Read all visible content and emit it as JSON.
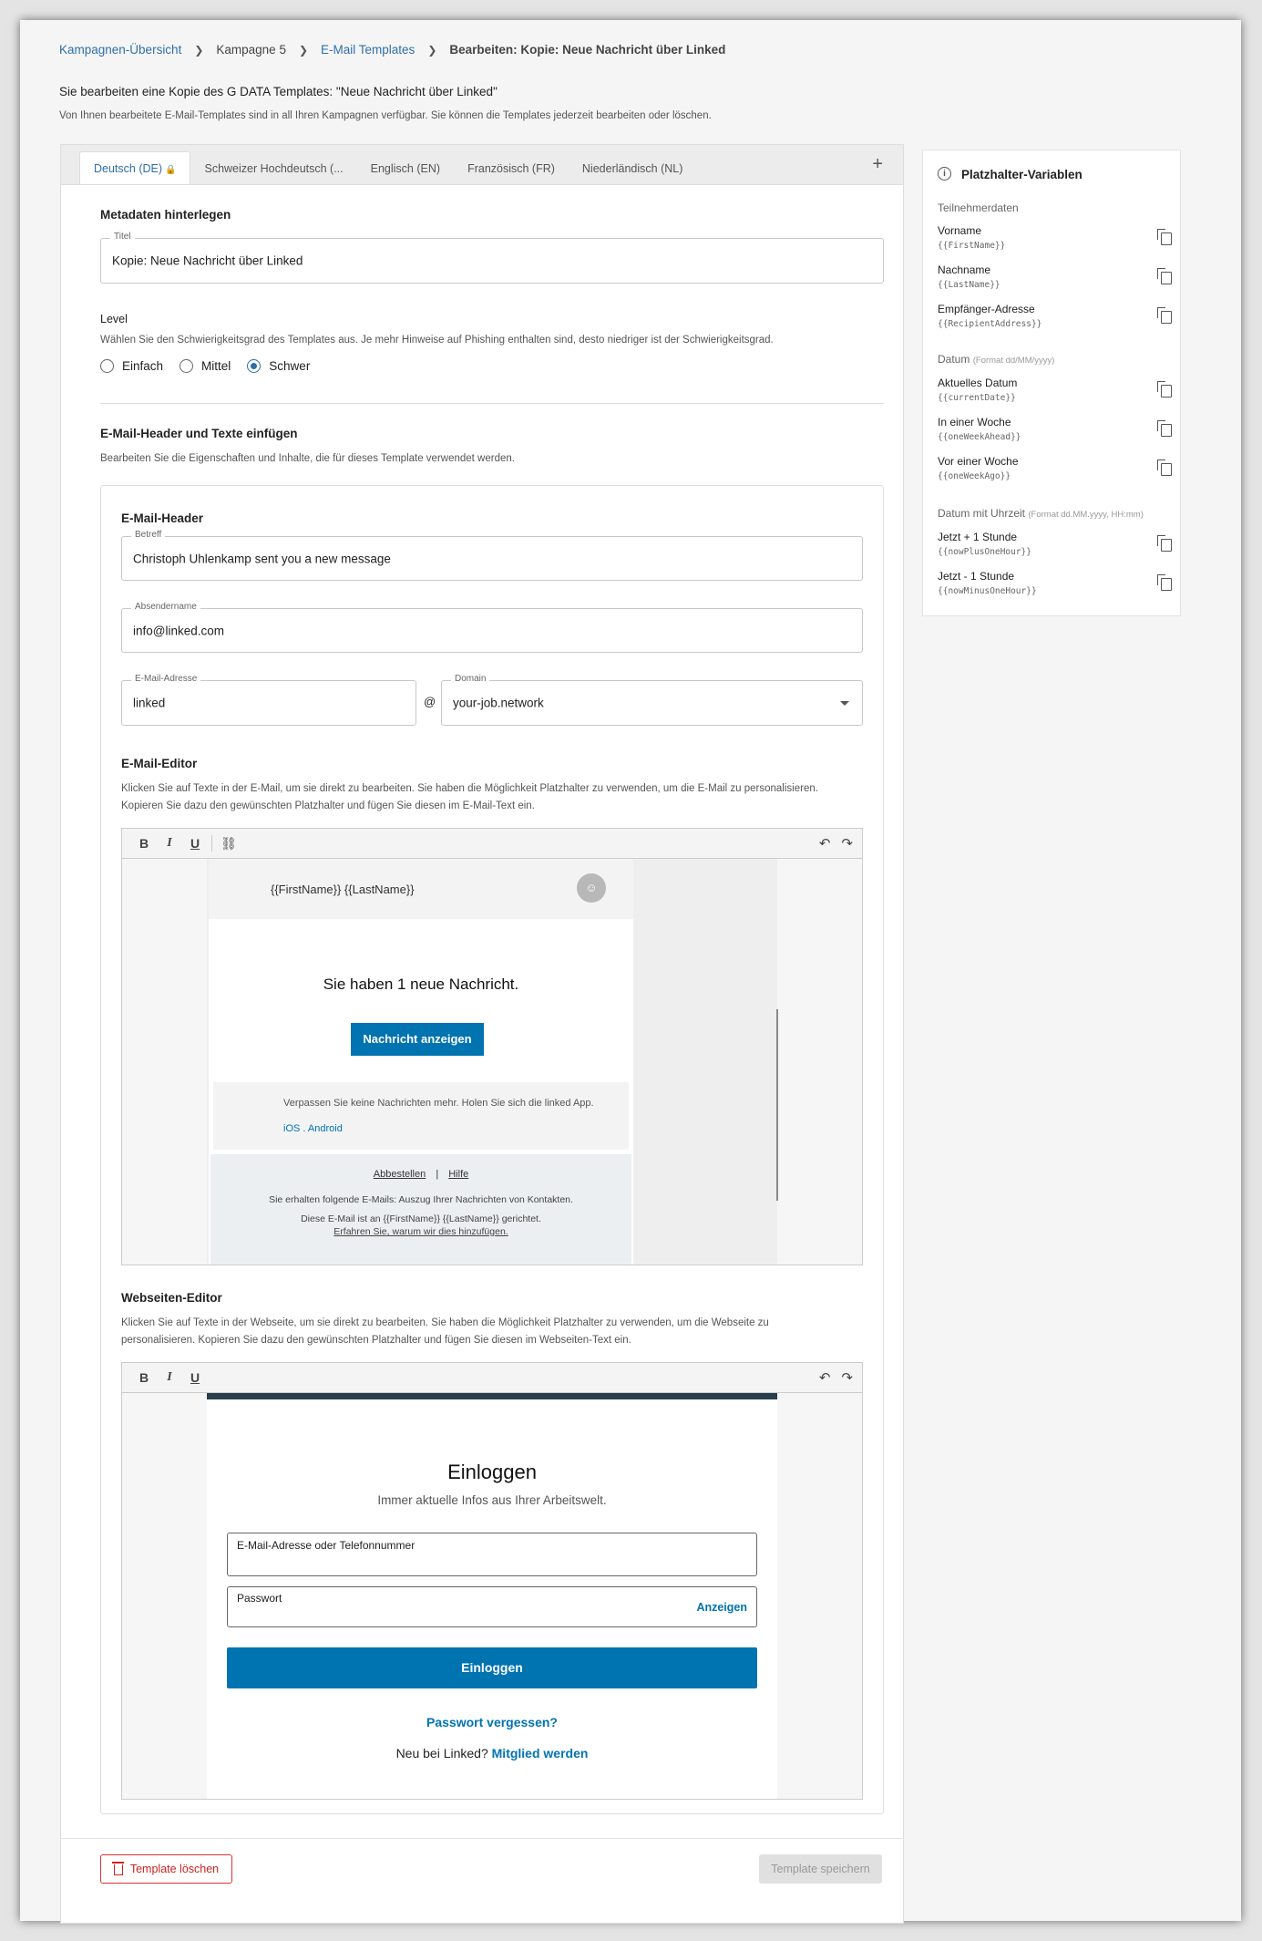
{
  "breadcrumb": {
    "items": [
      "Kampagnen-Übersicht",
      "Kampagne 5",
      "E-Mail Templates",
      "Bearbeiten: Kopie: Neue Nachricht über Linked"
    ]
  },
  "intro": {
    "title": "Sie bearbeiten eine Kopie des G DATA Templates: \"Neue Nachricht über Linked\"",
    "description": "Von Ihnen bearbeitete E-Mail-Templates sind in all Ihren Kampagnen verfügbar. Sie können die Templates jederzeit bearbeiten oder löschen."
  },
  "tabs": [
    {
      "label": "Deutsch (DE)"
    },
    {
      "label": "Schweizer Hochdeutsch (..."
    },
    {
      "label": "Englisch (EN)"
    },
    {
      "label": "Französisch (FR)"
    },
    {
      "label": "Niederländisch (NL)"
    }
  ],
  "add_tab": "+",
  "metadata": {
    "heading": "Metadaten hinterlegen",
    "title_label": "Titel",
    "title_value": "Kopie: Neue Nachricht über Linked"
  },
  "level": {
    "heading": "Level",
    "description": "Wählen Sie den Schwierigkeitsgrad des Templates aus. Je mehr Hinweise auf Phishing enthalten sind, desto niedriger ist der Schwierigkeitsgrad.",
    "options": [
      "Einfach",
      "Mittel",
      "Schwer"
    ],
    "selected": "Schwer"
  },
  "section": {
    "heading": "E-Mail-Header und Texte einfügen",
    "description": "Bearbeiten Sie die Eigenschaften und Inhalte, die für dieses Template verwendet werden."
  },
  "email_header": {
    "heading": "E-Mail-Header",
    "subject_label": "Betreff",
    "subject_value": "Christoph Uhlenkamp sent you a new message",
    "sender_label": "Absendername",
    "sender_value": "info@linked.com",
    "address_label": "E-Mail-Adresse",
    "address_value": "linked",
    "at": "@",
    "domain_label": "Domain",
    "domain_value": "your-job.network"
  },
  "email_editor": {
    "heading": "E-Mail-Editor",
    "description_1": "Klicken Sie auf Texte in der E-Mail, um sie direkt zu bearbeiten. Sie haben die Möglichkeit Platzhalter zu verwenden, um die E-Mail zu personalisieren.",
    "description_2": "Kopieren Sie dazu den gewünschten Platzhalter und fügen Sie diesen im E-Mail-Text ein."
  },
  "toolbar": {
    "bold": "B",
    "italic": "I",
    "underline": "U",
    "link": "⛓",
    "undo": "↶",
    "redo": "↷"
  },
  "mail": {
    "name": "{{FirstName}} {{LastName}}",
    "headline": "Sie haben 1 neue Nachricht.",
    "button": "Nachricht anzeigen",
    "app_text": "Verpassen Sie keine Nachrichten mehr. Holen Sie sich die linked App.",
    "ios": "iOS",
    "dot": ".",
    "android": "Android",
    "unsubscribe": "Abbestellen",
    "pipe": "|",
    "help": "Hilfe",
    "info": "Sie erhalten folgende E-Mails: Auszug Ihrer Nachrichten von Kontakten.",
    "addressed": "Diese E-Mail ist an {{FirstName}} {{LastName}} gerichtet.",
    "why": "Erfahren Sie, warum wir dies hinzufügen."
  },
  "web_editor": {
    "heading": "Webseiten-Editor",
    "description_1": "Klicken Sie auf Texte in der Webseite, um sie direkt zu bearbeiten. Sie haben die Möglichkeit Platzhalter zu verwenden, um die Webseite zu",
    "description_2": "personalisieren. Kopieren Sie dazu den gewünschten Platzhalter und fügen Sie diesen im Webseiten-Text ein."
  },
  "web": {
    "title": "Einloggen",
    "subtitle": "Immer aktuelle Infos aus Ihrer Arbeitswelt.",
    "email_placeholder": "E-Mail-Adresse oder Telefonnummer",
    "password_placeholder": "Passwort",
    "show": "Anzeigen",
    "login_button": "Einloggen",
    "forgot": "Passwort vergessen?",
    "new_text": "Neu bei Linked?",
    "join": "Mitglied werden"
  },
  "footer": {
    "delete": "Template löschen",
    "save": "Template speichern"
  },
  "sidebar": {
    "title": "Platzhalter-Variablen",
    "groups": [
      {
        "label": "Teilnehmerdaten",
        "note": "",
        "vars": [
          {
            "name": "Vorname",
            "code": "{{FirstName}}"
          },
          {
            "name": "Nachname",
            "code": "{{LastName}}"
          },
          {
            "name": "Empfänger-Adresse",
            "code": "{{RecipientAddress}}"
          }
        ]
      },
      {
        "label": "Datum",
        "note": "(Format dd/MM/yyyy)",
        "vars": [
          {
            "name": "Aktuelles Datum",
            "code": "{{currentDate}}"
          },
          {
            "name": "In einer Woche",
            "code": "{{oneWeekAhead}}"
          },
          {
            "name": "Vor einer Woche",
            "code": "{{oneWeekAgo}}"
          }
        ]
      },
      {
        "label": "Datum mit Uhrzeit",
        "note": "(Format dd.MM.yyyy, HH:mm)",
        "vars": [
          {
            "name": "Jetzt + 1 Stunde",
            "code": "{{nowPlusOneHour}}"
          },
          {
            "name": "Jetzt - 1 Stunde",
            "code": "{{nowMinusOneHour}}"
          }
        ]
      }
    ]
  },
  "colors": {
    "accent": "#2f6fa8",
    "linked_blue": "#0073b1",
    "danger": "#cc2222"
  }
}
